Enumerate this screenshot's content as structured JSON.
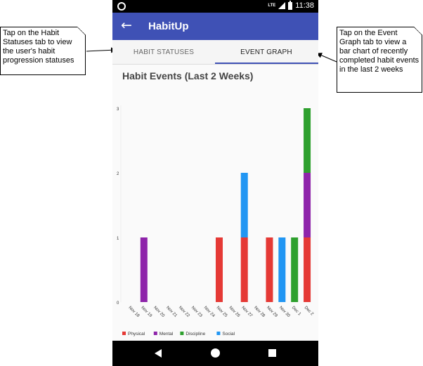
{
  "status_bar": {
    "network": "LTE",
    "time": "11:38"
  },
  "app_bar": {
    "back_icon": "arrow-left-icon",
    "title": "HabitUp"
  },
  "tabs": [
    {
      "label": "HABIT STATUSES",
      "selected": false
    },
    {
      "label": "EVENT GRAPH",
      "selected": true
    }
  ],
  "chart_title": "Habit Events (Last 2 Weeks)",
  "chart_data": {
    "type": "bar",
    "stacked": true,
    "title": "Habit Events (Last 2 Weeks)",
    "categories": [
      "Nov 18",
      "Nov 19",
      "Nov 20",
      "Nov 21",
      "Nov 22",
      "Nov 23",
      "Nov 24",
      "Nov 25",
      "Nov 26",
      "Nov 27",
      "Nov 28",
      "Nov 29",
      "Nov 30",
      "Dec 1",
      "Dec 2"
    ],
    "series": [
      {
        "name": "Physical",
        "color": "#e53935",
        "values": [
          0,
          0,
          0,
          0,
          0,
          0,
          0,
          1,
          0,
          1,
          0,
          1,
          0,
          0,
          1
        ]
      },
      {
        "name": "Mental",
        "color": "#8e24aa",
        "values": [
          0,
          1,
          0,
          0,
          0,
          0,
          0,
          0,
          0,
          0,
          0,
          0,
          0,
          0,
          1
        ]
      },
      {
        "name": "Discipline",
        "color": "#2ea02e",
        "values": [
          0,
          0,
          0,
          0,
          0,
          0,
          0,
          0,
          0,
          0,
          0,
          0,
          0,
          1,
          1
        ]
      },
      {
        "name": "Social",
        "color": "#2196f3",
        "values": [
          0,
          0,
          0,
          0,
          0,
          0,
          0,
          0,
          0,
          1,
          0,
          0,
          1,
          0,
          0
        ]
      }
    ],
    "yticks": [
      0,
      1,
      2,
      3
    ],
    "ylim": [
      0,
      3
    ],
    "legend_position": "bottom-left"
  },
  "callouts": {
    "left": "Tap on the Habit Statuses tab to view the user's habit progression statuses",
    "right": "Tap on the Event Graph tab to view a bar chart of recently completed habit events in the last 2 weeks"
  }
}
